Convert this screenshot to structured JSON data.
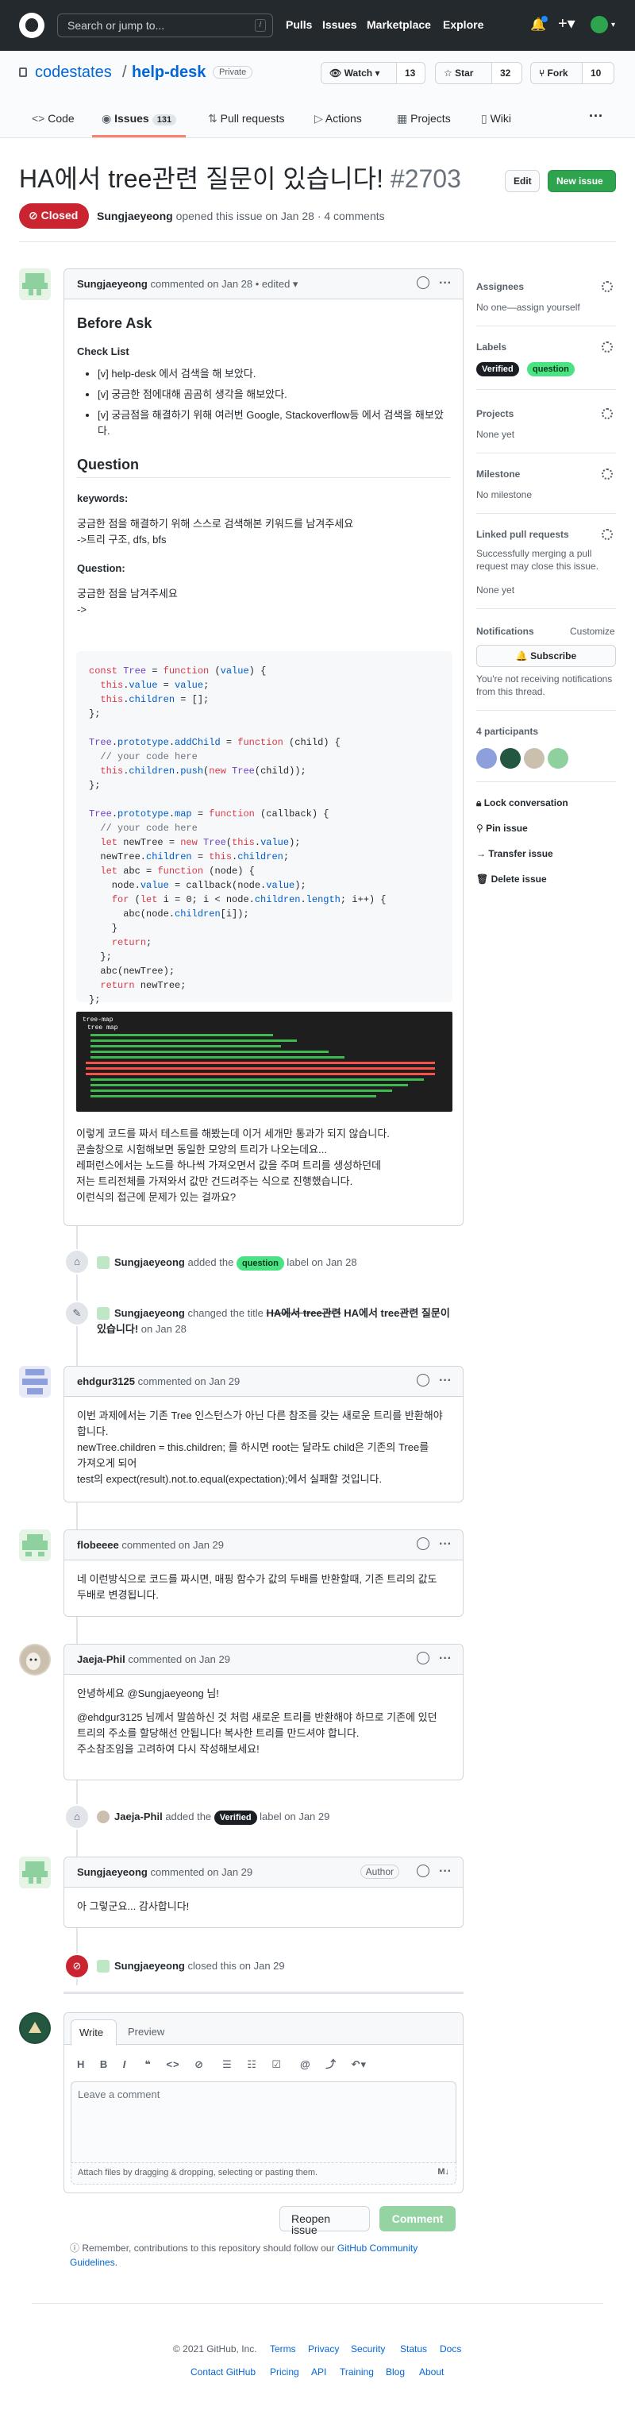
{
  "header": {
    "search_placeholder": "Search or jump to...",
    "search_shortcut": "/",
    "nav": [
      "Pulls",
      "Issues",
      "Marketplace",
      "Explore"
    ]
  },
  "repo": {
    "owner": "codestates",
    "separator": "/",
    "name": "help-desk",
    "visibility": "Private",
    "watch_label": "Watch",
    "watch_count": "13",
    "star_label": "Star",
    "star_count": "32",
    "fork_label": "Fork",
    "fork_count": "10",
    "tabs": [
      {
        "label": "Code"
      },
      {
        "label": "Issues",
        "count": "131"
      },
      {
        "label": "Pull requests"
      },
      {
        "label": "Actions"
      },
      {
        "label": "Projects"
      },
      {
        "label": "Wiki"
      }
    ],
    "more": "···"
  },
  "issue": {
    "title": "HA에서 tree관련 질문이 있습니다!",
    "number": "#2703",
    "edit_label": "Edit",
    "new_issue_label": "New issue",
    "state": "Closed",
    "author": "Sungjaeyeong",
    "meta": "opened this issue on Jan 28 · 4 comments"
  },
  "first_comment": {
    "author": "Sungjaeyeong",
    "meta": "commented on Jan 28 • edited ▾",
    "h_before": "Before Ask",
    "h_checklist": "Check List",
    "checklist": [
      "[v] help-desk 에서 검색을 해 보았다.",
      "[v] 궁금한 점에대해 곰곰히 생각을 해보았다.",
      "[v] 궁금점을 해결하기 위해 여러번 Google, Stackoverflow등 에서 검색을 해보았다."
    ],
    "h_question": "Question",
    "keywords_label": "keywords:",
    "keywords_text1": "궁금한 점을 해결하기 위해 스스로 검색해본 키워드를 남겨주세요",
    "keywords_text2": "->트리 구조, dfs, bfs",
    "question_label": "Question:",
    "question_text1": "궁금한 점을 남겨주세요",
    "question_text2": "->",
    "code_lines": [
      "const Tree = function (value) {",
      "  this.value = value;",
      "  this.children = [];",
      "};",
      "",
      "Tree.prototype.addChild = function (child) {",
      "  // your code here",
      "  this.children.push(new Tree(child));",
      "};",
      "",
      "Tree.prototype.map = function (callback) {",
      "  // your code here",
      "  let newTree = new Tree(this.value);",
      "  newTree.children = this.children;",
      "  let abc = function (node) {",
      "    node.value = callback(node.value);",
      "    for (let i = 0; i < node.children.length; i++) {",
      "      abc(node.children[i]);",
      "    }",
      "    return;",
      "  };",
      "  abc(newTree);",
      "  return newTree;",
      "};"
    ],
    "terminal_title": "tree-map",
    "terminal_sub": "tree map",
    "after": [
      "이렇게 코드를 짜서 테스트를 해봤는데 이거 세개만 통과가 되지 않습니다.",
      "콘솔창으로 시험해보면 동일한 모양의 트리가 나오는데요...",
      "레퍼런스에서는 노드를 하나씩 가져오면서 값을 주며 트리를 생성하던데",
      "저는 트리전체를 가져와서 값만 건드려주는 식으로 진행했습니다.",
      "이런식의 접근에 문제가 있는 걸까요?"
    ]
  },
  "events": {
    "label_added_user": "Sungjaeyeong",
    "label_added_text": "added the",
    "label_question": "question",
    "label_added_suffix": "label on Jan 28",
    "rename_user": "Sungjaeyeong",
    "rename_text": "changed the title",
    "rename_old": "HA에서 tree관련",
    "rename_new": "HA에서 tree관련 질문이 있습니다!",
    "rename_suffix": "on Jan 28",
    "verified_user": "Jaeja-Phil",
    "verified_text": "added the",
    "label_verified": "Verified",
    "verified_suffix": "label on Jan 29",
    "closed_user": "Sungjaeyeong",
    "closed_text": "closed this on Jan 29"
  },
  "comments": [
    {
      "author": "ehdgur3125",
      "meta": "commented on Jan 29",
      "lines": [
        "이번 과제에서는 기존 Tree 인스턴스가 아닌 다른 참조를 갖는 새로운 트리를 반환해야",
        "합니다.",
        "newTree.children = this.children; 를 하시면 root는 달라도 child은 기존의 Tree를",
        "가져오게 되어",
        "test의 expect(result).not.to.equal(expectation);에서 실패할 것입니다."
      ]
    },
    {
      "author": "flobeeee",
      "meta": "commented on Jan 29",
      "lines": [
        "네 이런방식으로 코드를 짜시면, 매핑 함수가 값의 두배를 반환할때, 기존 트리의 값도",
        "두배로 변경됩니다."
      ]
    },
    {
      "author": "Jaeja-Phil",
      "meta": "commented on Jan 29",
      "greet": "안녕하세요 @Sungjaeyeong 님!",
      "lines": [
        "@ehdgur3125 님께서 말씀하신 것 처럼 새로운 트리를 반환해야 하므로 기존에 있던",
        "트리의 주소를 할당해선 안됩니다! 복사한 트리를 만드셔야 합니다.",
        "주소참조임을 고려하여 다시 작성해보세요!"
      ]
    },
    {
      "author": "Sungjaeyeong",
      "meta": "commented on Jan 29",
      "badge": "Author",
      "lines": [
        "아 그렇군요... 감사합니다!"
      ]
    }
  ],
  "reply": {
    "tab_write": "Write",
    "tab_preview": "Preview",
    "placeholder": "Leave a comment",
    "attach": "Attach files by dragging & dropping, selecting or pasting them.",
    "reopen": "Reopen issue",
    "comment": "Comment",
    "guideline_prefix": "Remember, contributions to this repository should follow our",
    "guideline_link1": "GitHub Community",
    "guideline_link2": "Guidelines."
  },
  "sidebar": {
    "assignees_h": "Assignees",
    "assignees_v": "No one—assign yourself",
    "labels_h": "Labels",
    "labels": [
      "Verified",
      "question"
    ],
    "projects_h": "Projects",
    "projects_v": "None yet",
    "milestone_h": "Milestone",
    "milestone_v": "No milestone",
    "linked_h": "Linked pull requests",
    "linked_desc1": "Successfully merging a pull",
    "linked_desc2": "request may close this issue.",
    "linked_v": "None yet",
    "notif_h": "Notifications",
    "notif_customize": "Customize",
    "subscribe": "Subscribe",
    "notif_desc1": "You're not receiving notifications",
    "notif_desc2": "from this thread.",
    "participants": "4 participants",
    "lock": "Lock conversation",
    "pin": "Pin issue",
    "transfer": "Transfer issue",
    "delete": "Delete issue"
  },
  "footer": {
    "copyright": "© 2021 GitHub, Inc.",
    "row1": [
      "Terms",
      "Privacy",
      "Security",
      "Status",
      "Docs"
    ],
    "row2": [
      "Contact GitHub",
      "Pricing",
      "API",
      "Training",
      "Blog",
      "About"
    ]
  },
  "colors": {
    "closed": "#cb2431",
    "green": "#2ea44f",
    "link": "#0366d6",
    "label_green": "#4ae282"
  }
}
